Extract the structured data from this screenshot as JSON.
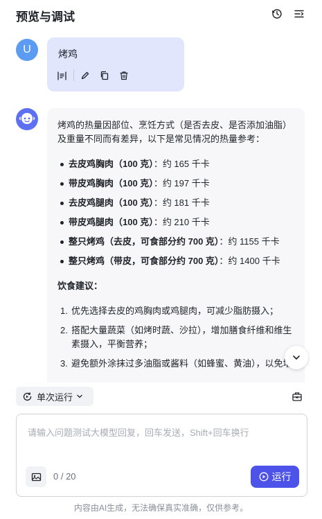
{
  "header": {
    "title": "预览与调试",
    "history_icon": "history-icon",
    "menu_icon": "list-menu-icon"
  },
  "user_message": {
    "avatar_letter": "U",
    "text": "烤鸡",
    "tools": [
      "text-align-icon",
      "edit-icon",
      "copy-icon",
      "delete-icon"
    ]
  },
  "bot_message": {
    "intro": "烤鸡的热量因部位、烹饪方式（是否去皮、是否添加油脂）及重量不同而有差异，以下是常见情况的热量参考：",
    "items": [
      {
        "name": "去皮鸡胸肉（100 克）",
        "value": "：约 165 千卡"
      },
      {
        "name": "带皮鸡胸肉（100 克）",
        "value": "：约 197 千卡"
      },
      {
        "name": "去皮鸡腿肉（100 克）",
        "value": "：约 181 千卡"
      },
      {
        "name": "带皮鸡腿肉（100 克）",
        "value": "：约 210 千卡"
      },
      {
        "name": "整只烤鸡（去皮，可食部分约 700 克）",
        "value": "：约 1155 千卡"
      },
      {
        "name": "整只烤鸡（带皮，可食部分约 700 克）",
        "value": "：约 1400 千卡"
      }
    ],
    "advice_title": "饮食建议：",
    "advice": [
      {
        "num": "1.",
        "text": "优先选择去皮的鸡胸肉或鸡腿肉，可减少脂肪摄入；"
      },
      {
        "num": "2.",
        "text": "搭配大量蔬菜（如烤时蔬、沙拉），增加膳食纤维和维生素摄入，平衡营养；"
      },
      {
        "num": "3.",
        "text": "避免额外涂抹过多油脂或酱料（如蜂蜜、黄油），以免增"
      }
    ]
  },
  "run_mode": {
    "label": "单次运行"
  },
  "input": {
    "placeholder": "请输入问题测试大模型回复，回车发送，Shift+回车换行",
    "value": "",
    "counter": "0 / 20"
  },
  "run_button": {
    "label": "运行"
  },
  "footer": {
    "note": "内容由AI生成，无法确保真实准确，仅供参考。"
  },
  "colors": {
    "accent": "#4d53e8",
    "user_bubble": "#e1e6fd",
    "bot_bubble": "#f7f7f9",
    "user_avatar": "#5b9bf2",
    "bot_avatar": "#5d6ff3"
  }
}
